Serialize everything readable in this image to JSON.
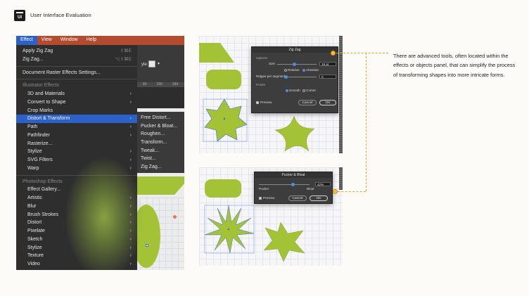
{
  "header": {
    "logo_text": "UI",
    "title": "User Interface Evaluation"
  },
  "menubar": {
    "items": [
      "Effect",
      "View",
      "Window",
      "Help"
    ]
  },
  "toolbar": {
    "style_label": "yle:",
    "style_dd": "▾",
    "ruler_marks": [
      "80",
      "260",
      "280"
    ]
  },
  "effect_menu": {
    "top_items": [
      {
        "label": "Apply Zig Zag",
        "shortcut": "⇧⌘E"
      },
      {
        "label": "Zig Zag...",
        "shortcut": "⌥⇧⌘E"
      }
    ],
    "raster_item": {
      "label": "Document Raster Effects Settings..."
    },
    "illustrator_header": "Illustrator Effects",
    "illustrator_items": [
      {
        "label": "3D and Materials",
        "arrow": "›"
      },
      {
        "label": "Convert to Shape",
        "arrow": "›"
      },
      {
        "label": "Crop Marks",
        "arrow": ""
      },
      {
        "label": "Distort & Transform",
        "arrow": "›"
      },
      {
        "label": "Path",
        "arrow": "›"
      },
      {
        "label": "Pathfinder",
        "arrow": "›"
      },
      {
        "label": "Rasterize...",
        "arrow": ""
      },
      {
        "label": "Stylize",
        "arrow": "›"
      },
      {
        "label": "SVG Filters",
        "arrow": "›"
      },
      {
        "label": "Warp",
        "arrow": "›"
      }
    ],
    "photoshop_header": "Photoshop Effects",
    "photoshop_items": [
      {
        "label": "Effect Gallery...",
        "arrow": ""
      },
      {
        "label": "Artistic",
        "arrow": "›"
      },
      {
        "label": "Blur",
        "arrow": "›"
      },
      {
        "label": "Brush Strokes",
        "arrow": "›"
      },
      {
        "label": "Distort",
        "arrow": "›"
      },
      {
        "label": "Pixelate",
        "arrow": "›"
      },
      {
        "label": "Sketch",
        "arrow": "›"
      },
      {
        "label": "Stylize",
        "arrow": "›"
      },
      {
        "label": "Texture",
        "arrow": "›"
      },
      {
        "label": "Video",
        "arrow": "›"
      }
    ]
  },
  "distort_submenu": {
    "items": [
      "Free Distort...",
      "Pucker & Bloat...",
      "Roughen...",
      "Transform...",
      "Tweak...",
      "Twist...",
      "Zig Zag..."
    ]
  },
  "zigzag_dialog": {
    "title": "Zig Zag",
    "options_label": "Options",
    "size_label": "Size",
    "size_value": "19 pt",
    "relative_label": "Relative",
    "absolute_label": "Absolute",
    "ridges_label": "Ridges per segment",
    "ridges_value": "0",
    "points_label": "Points",
    "smooth_label": "Smooth",
    "corner_label": "Corner",
    "preview_label": "Preview",
    "cancel_label": "Cancel",
    "ok_label": "OK"
  },
  "pucker_dialog": {
    "title": "Pucker & Bloat",
    "value": "42%",
    "pucker_label": "Pucker",
    "bloat_label": "Bloat",
    "preview_label": "Preview",
    "cancel_label": "Cancel",
    "ok_label": "OK"
  },
  "description": "There are advanced tools, often located within the effects or objects panel, that can simplify the process of transforming shapes into more intricate forms.",
  "colors": {
    "accent_connector": "#f0a020",
    "shape_green": "#a3c236",
    "menu_highlight": "#2b61c8",
    "menubar": "#b44a2e"
  }
}
